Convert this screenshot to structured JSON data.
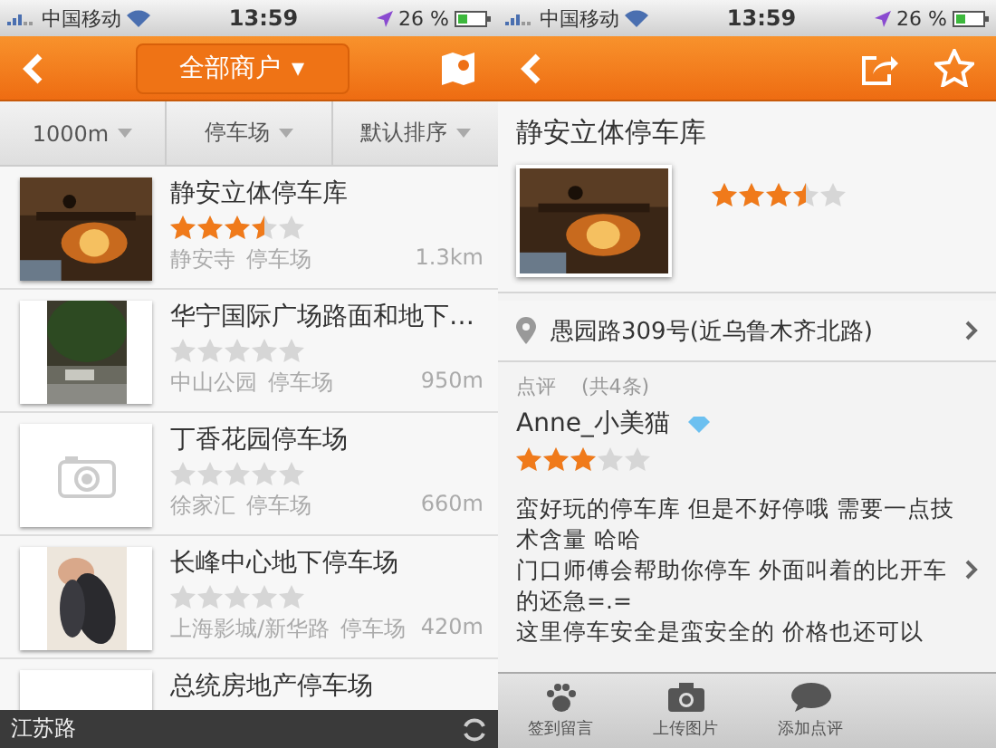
{
  "screens": [
    {
      "status_bar": {
        "carrier": "中国移动",
        "time": "13:59",
        "battery": "26 %"
      },
      "nav": {
        "title": "全部商户",
        "caret": "▾"
      },
      "filters": [
        {
          "label": "1000m"
        },
        {
          "label": "停车场"
        },
        {
          "label": "默认排序"
        }
      ],
      "merchants": [
        {
          "name": "静安立体停车库",
          "stars": 3.5,
          "area": "静安寺",
          "category": "停车场",
          "distance": "1.3km"
        },
        {
          "name": "华宁国际广场路面和地下…",
          "stars": 0,
          "area": "中山公园",
          "category": "停车场",
          "distance": "950m"
        },
        {
          "name": "丁香花园停车场",
          "stars": 0,
          "area": "徐家汇",
          "category": "停车场",
          "distance": "660m"
        },
        {
          "name": "长峰中心地下停车场",
          "stars": 0,
          "area": "上海影城/新华路",
          "category": "停车场",
          "distance": "420m"
        },
        {
          "name": "总统房地产停车场"
        }
      ],
      "location_bar": {
        "text": "江苏路"
      }
    },
    {
      "status_bar": {
        "carrier": "中国移动",
        "time": "13:59",
        "battery": "26 %"
      },
      "detail": {
        "name": "静安立体停车库",
        "stars": 3.5,
        "address": "愚园路309号(近乌鲁木齐北路)"
      },
      "reviews": {
        "label": "点评",
        "count": "(共4条)",
        "items": [
          {
            "user": "Anne_小美猫",
            "stars": 3,
            "paragraphs": [
              "蛮好玩的停车库 但是不好停哦 需要一点技术含量 哈哈",
              "门口师傅会帮助你停车 外面叫着的比开车的还急=.=",
              "这里停车安全是蛮安全的 价格也还可以"
            ]
          }
        ]
      },
      "toolbar": [
        {
          "kind": "paw",
          "label": "签到留言"
        },
        {
          "kind": "camera",
          "label": "上传图片"
        },
        {
          "kind": "chat",
          "label": "添加点评"
        }
      ]
    }
  ]
}
